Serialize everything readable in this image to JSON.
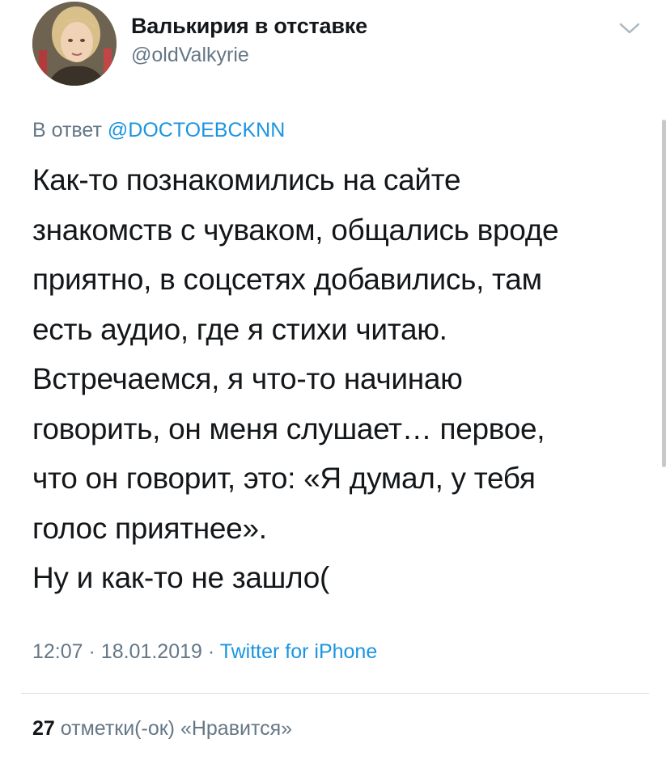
{
  "author": {
    "name": "Валькирия в отставке",
    "handle": "@oldValkyrie"
  },
  "reply": {
    "prefix": "В ответ",
    "mention": "@DOCTOEBCKNN"
  },
  "tweet": {
    "lines": [
      "Как-то познакомились на сайте",
      "знакомств с чуваком, общались вроде",
      "приятно, в соцсетях добавились, там",
      "есть аудио, где я стихи читаю.",
      "Встречаемся, я что-то начинаю",
      "говорить, он меня слушает… первое,",
      "что он говорит, это: «Я думал, у тебя",
      "голос приятнее».",
      "Ну и как-то не зашло("
    ]
  },
  "meta": {
    "time": "12:07",
    "date": "18.01.2019",
    "separator": "·",
    "source": "Twitter for iPhone"
  },
  "likes": {
    "count": "27",
    "label": "отметки(-ок) «Нравится»"
  },
  "icons": {
    "menu": "chevron-down-icon",
    "avatar": "profile-photo"
  },
  "colors": {
    "text": "#14171a",
    "secondary": "#657786",
    "link": "#1b95e0",
    "divider": "#d6dde3"
  }
}
